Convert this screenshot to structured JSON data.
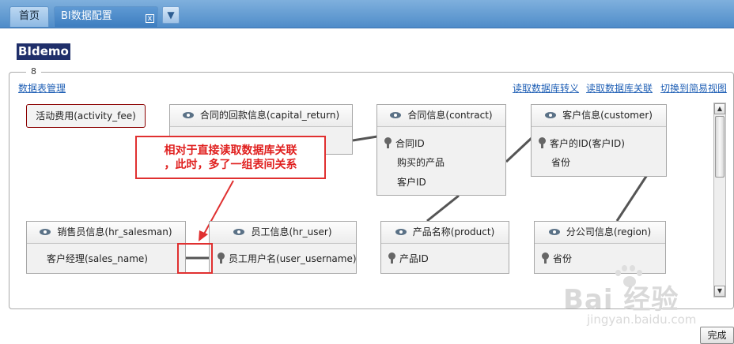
{
  "tabs": {
    "home": "首页",
    "active": "BI数据配置",
    "close": "x",
    "menu": "▼"
  },
  "page_title": "BIdemo",
  "fieldset_legend": "8",
  "links": {
    "manage": "数据表管理",
    "read_transfer": "读取数据库转义",
    "read_relation": "读取数据库关联",
    "switch_view": "切换到简易视图"
  },
  "standalone_table": "活动费用(activity_fee)",
  "tables": {
    "capital_return": {
      "title": "合同的回款信息(capital_return)"
    },
    "contract": {
      "title": "合同信息(contract)",
      "fields": [
        "合同ID",
        "购买的产品",
        "客户ID"
      ]
    },
    "customer": {
      "title": "客户信息(customer)",
      "fields": [
        "客户的ID(客户ID)",
        "省份"
      ]
    },
    "hr_salesman": {
      "title": "销售员信息(hr_salesman)",
      "fields": [
        "客户经理(sales_name)"
      ]
    },
    "hr_user": {
      "title": "员工信息(hr_user)",
      "fields": [
        "员工用户名(user_username)"
      ]
    },
    "product": {
      "title": "产品名称(product)",
      "fields": [
        "产品ID"
      ]
    },
    "region": {
      "title": "分公司信息(region)",
      "fields": [
        "省份"
      ]
    }
  },
  "callout": {
    "line1": "相对于直接读取数据库关联",
    "line2": "，此时，多了一组表间关系"
  },
  "buttons": {
    "done": "完成"
  },
  "watermark": {
    "brand": "Bai  经验",
    "url": "jingyan.baidu.com"
  },
  "colors": {
    "topbar": "#4f8cc9",
    "title_bg": "#1f2f6a",
    "callout": "#e03030",
    "link": "#1f5fb5"
  }
}
